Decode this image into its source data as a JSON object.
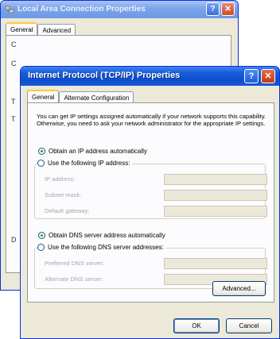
{
  "back_window": {
    "title": "Local Area Connection Properties",
    "help_glyph": "?",
    "close_glyph": "✕",
    "tabs": [
      {
        "label": "General",
        "active": true
      },
      {
        "label": "Advanced",
        "active": false
      }
    ],
    "panel_glyphs": [
      "C",
      "C",
      "T",
      "T",
      "D"
    ]
  },
  "front_window": {
    "title": "Internet Protocol (TCP/IP) Properties",
    "help_glyph": "?",
    "close_glyph": "✕",
    "tabs": [
      {
        "label": "General",
        "active": true
      },
      {
        "label": "Alternate Configuration",
        "active": false
      }
    ],
    "description": "You can get IP settings assigned automatically if your network supports this capability. Otherwise, you need to ask your network administrator for the appropriate IP settings.",
    "ip": {
      "auto_label": "Obtain an IP address automatically",
      "auto_selected": true,
      "manual_label": "Use the following IP address:",
      "fields": {
        "ip_address": "IP address:",
        "subnet_mask": "Subnet mask:",
        "default_gateway": "Default gateway:"
      }
    },
    "dns": {
      "auto_label": "Obtain DNS server address automatically",
      "auto_selected": true,
      "manual_label": "Use the following DNS server addresses:",
      "fields": {
        "preferred": "Preferred DNS server:",
        "alternate": "Alternate DNS server:"
      }
    },
    "buttons": {
      "advanced": "Advanced...",
      "ok": "OK",
      "cancel": "Cancel"
    }
  },
  "colors": {
    "titlebar_active": "#0d4fcf",
    "titlebar_inactive": "#7fa6ea",
    "dialog_face": "#ece9d8",
    "radio_dot": "#21a121",
    "disabled_text": "#a7a6aa"
  }
}
